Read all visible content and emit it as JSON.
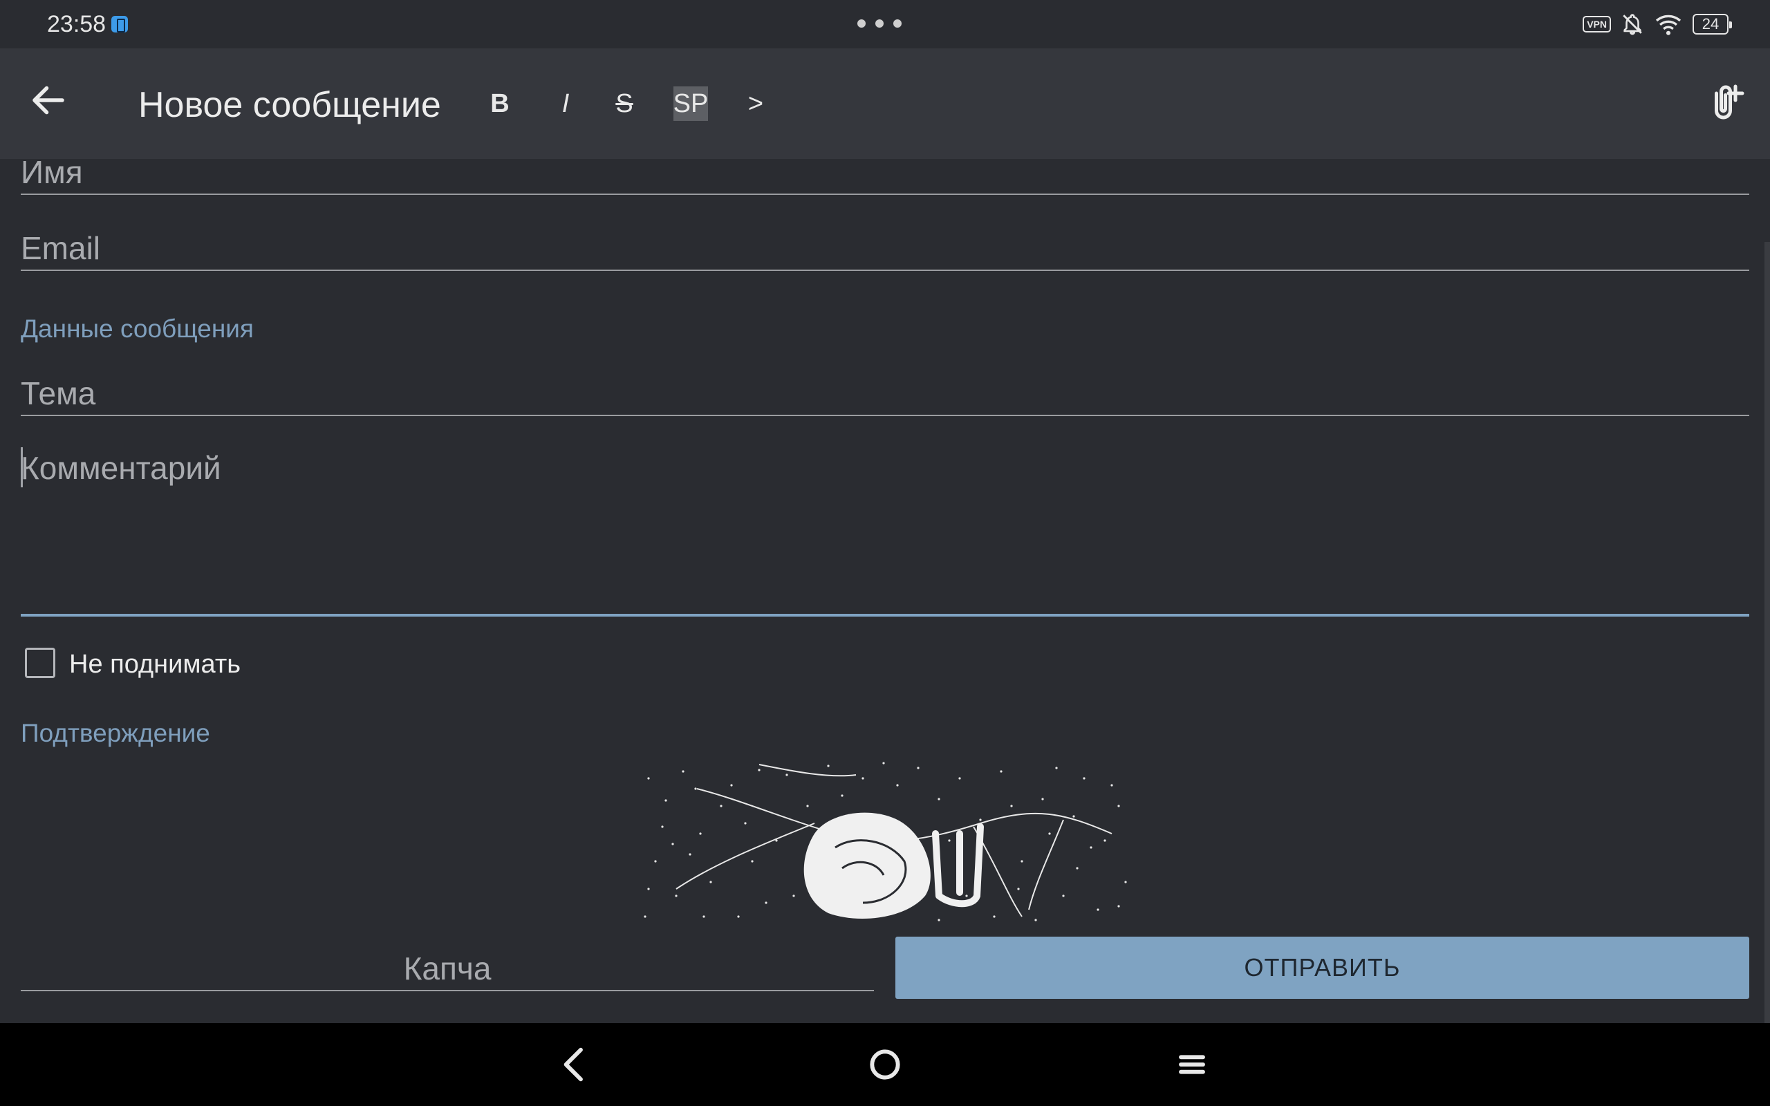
{
  "status_bar": {
    "time": "23:58",
    "vpn_label": "VPN",
    "battery": "24",
    "icons": [
      "notification-badge-icon",
      "vpn-icon",
      "bell-off-icon",
      "wifi-icon",
      "battery-icon"
    ]
  },
  "app_bar": {
    "title": "Новое сообщение",
    "format_buttons": {
      "bold": "B",
      "italic": "I",
      "strike": "S",
      "spoiler": "SP",
      "quote": ">"
    }
  },
  "form": {
    "name_placeholder": "Имя",
    "email_placeholder": "Email",
    "section_message": "Данные сообщения",
    "subject_placeholder": "Тема",
    "comment_placeholder": "Комментарий",
    "no_bump_label": "Не поднимать",
    "no_bump_checked": false,
    "section_confirm": "Подтверждение",
    "captcha_placeholder": "Капча",
    "submit_label": "ОТПРАВИТЬ"
  },
  "colors": {
    "background": "#2a2c31",
    "app_bar": "#35373d",
    "accent": "#7fa3c2",
    "section_title": "#7f9fbd"
  }
}
